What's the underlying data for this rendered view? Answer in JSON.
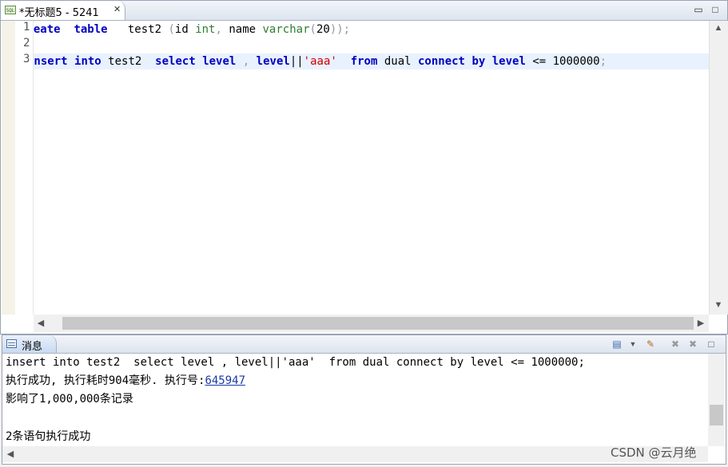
{
  "editor": {
    "tab_title": "*无标题5 - 5241",
    "tab_icon_text": "SQL",
    "close_symbol": "✕",
    "minimize_symbol": "▭",
    "maximize_symbol": "□",
    "line_numbers": [
      "1",
      "2",
      "3"
    ],
    "line1": {
      "kw1": "create",
      "sp1": "  ",
      "kw2": "table",
      "sp2": "   test2 ",
      "p1": "(",
      "id": "id ",
      "ty1": "int",
      "comma": ",",
      "name": " name ",
      "ty2": "varchar",
      "p2": "(",
      "num": "20",
      "p3": "));"
    },
    "line3": {
      "kw1": "insert",
      "s1": " ",
      "kw2": "into",
      "s2": " test2  ",
      "kw3": "select",
      "s3": " ",
      "kw4": "level",
      "s4": " ",
      "comma": ",",
      "s5": " ",
      "kw5": "level",
      "pipes": "||",
      "str": "'aaa'",
      "s6": "  ",
      "kw6": "from",
      "s7": " dual ",
      "kw7": "connect",
      "s8": " ",
      "kw8": "by",
      "s9": " ",
      "kw9": "level",
      "s10": " <= 1000000",
      "semi": ";"
    }
  },
  "messages": {
    "tab_label": "消息",
    "line1": "insert into test2  select level , level||'aaa'  from dual connect by level <= 1000000;",
    "line2_prefix": "执行成功, 执行耗时904毫秒. 执行号:",
    "exec_id": "645947",
    "line3": "影响了1,000,000条记录",
    "line4": "",
    "line5": "2条语句执行成功"
  },
  "watermark": "CSDN @云月绝",
  "colors": {
    "keyword": "#0000c0",
    "type": "#2e7d32",
    "string": "#d00000",
    "current_line": "#e8f2fe"
  }
}
